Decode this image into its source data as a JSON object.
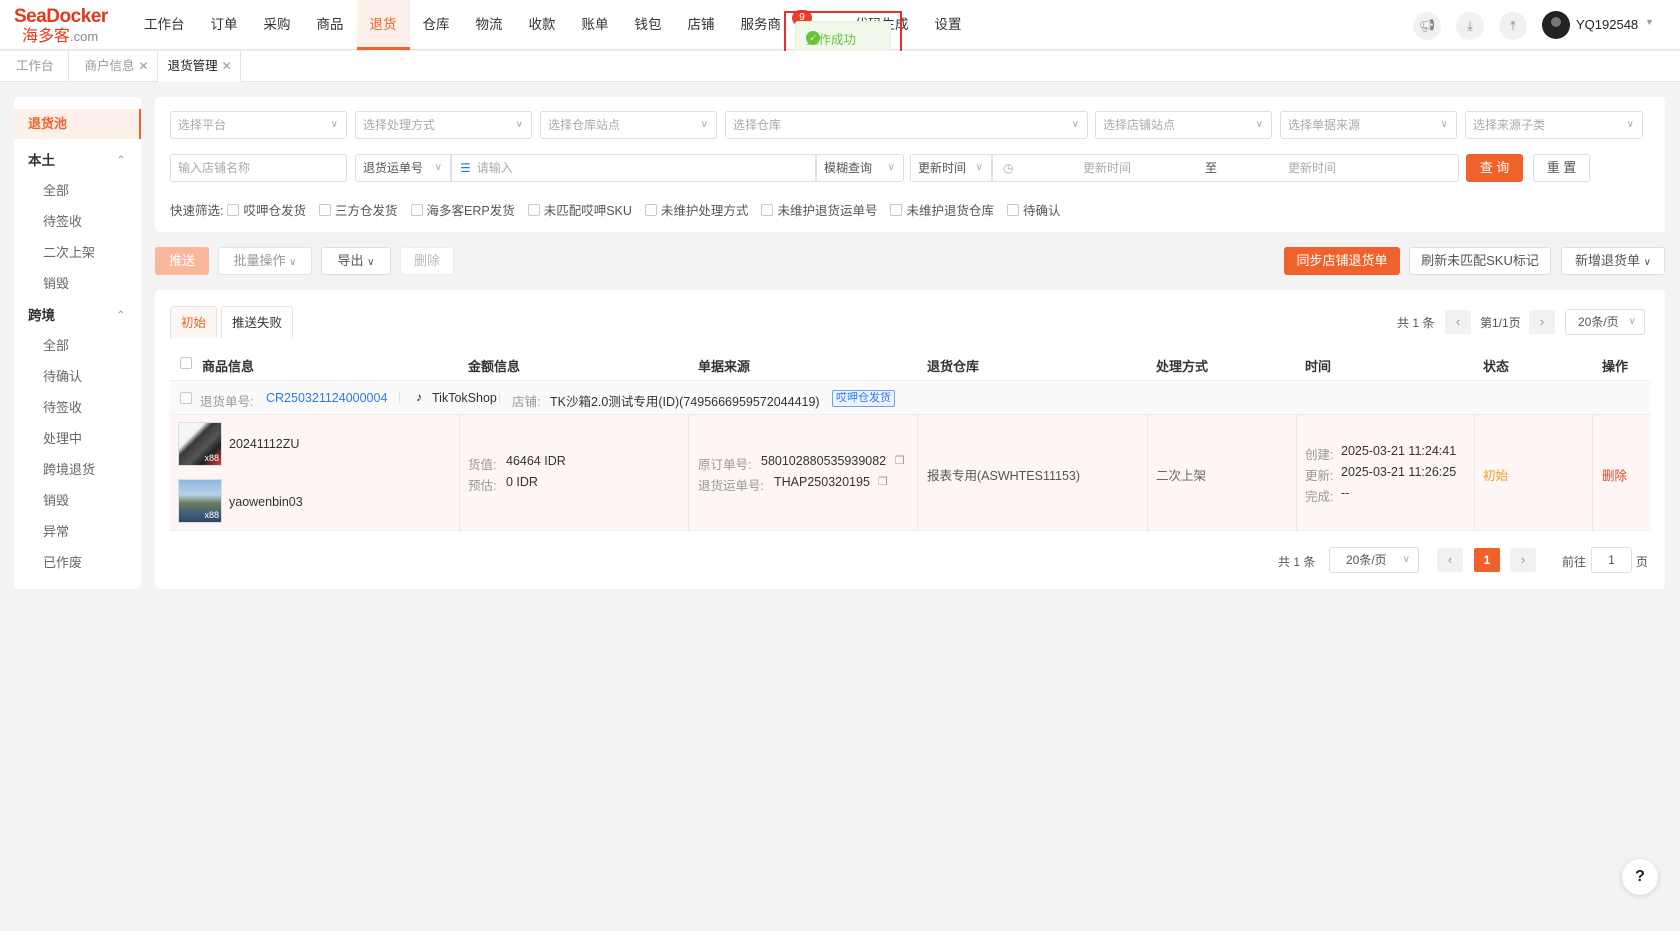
{
  "brand": {
    "en": "SeaDocker",
    "zh": "海多客",
    "suffix": ".com"
  },
  "nav": {
    "items": [
      "工作台",
      "订单",
      "采购",
      "商品",
      "退货",
      "仓库",
      "物流",
      "收款",
      "账单",
      "钱包",
      "店铺",
      "服务商",
      "代码生成",
      "设置"
    ],
    "active": "退货",
    "badge": "9"
  },
  "header": {
    "username": "YQ192548"
  },
  "toast": {
    "message": "操作成功"
  },
  "page_tabs": [
    {
      "label": "工作台",
      "closable": false
    },
    {
      "label": "商户信息",
      "closable": true
    },
    {
      "label": "退货管理",
      "closable": true,
      "active": true
    }
  ],
  "sidebar": {
    "top": "退货池",
    "groups": [
      {
        "title": "本土",
        "items": [
          "全部",
          "待签收",
          "二次上架",
          "销毁"
        ]
      },
      {
        "title": "跨境",
        "items": [
          "全部",
          "待确认",
          "待签收",
          "处理中",
          "跨境退货",
          "销毁",
          "异常",
          "已作废"
        ]
      }
    ]
  },
  "filters": {
    "row1": [
      "选择平台",
      "选择处理方式",
      "选择仓库站点",
      "选择仓库",
      "选择店铺站点",
      "选择单据来源",
      "选择来源子类"
    ],
    "store_name_placeholder": "输入店铺名称",
    "return_no_select": "退货运单号",
    "input_placeholder": "请输入",
    "fuzzy_select": "模糊查询",
    "time_select": "更新时间",
    "date_start_placeholder": "更新时间",
    "date_sep": "至",
    "date_end_placeholder": "更新时间",
    "query_button": "查 询",
    "reset_button": "重 置",
    "quick_label": "快速筛选:",
    "quick_items": [
      "哎呷仓发货",
      "三方仓发货",
      "海多客ERP发货",
      "未匹配哎呷SKU",
      "未维护处理方式",
      "未维护退货运单号",
      "未维护退货仓库",
      "待确认"
    ]
  },
  "actions": {
    "push": "推送",
    "batch": "批量操作",
    "export": "导出",
    "delete": "删除",
    "sync": "同步店铺退货单",
    "refresh": "刷新未匹配SKU标记",
    "add": "新增退货单"
  },
  "table_tabs": [
    "初始",
    "推送失败"
  ],
  "pager_top": {
    "total": "共 1 条",
    "page": "第1/1页",
    "size": "20条/页"
  },
  "columns": [
    "商品信息",
    "金额信息",
    "单据来源",
    "退货仓库",
    "处理方式",
    "时间",
    "状态",
    "操作"
  ],
  "order": {
    "return_no_label": "退货单号:",
    "return_no": "CR250321124000004",
    "platform": "TikTokShop",
    "store_label": "店铺:",
    "store": "TK沙箱2.0测试专用(ID)(7495666959572044419)",
    "tag": "哎呷仓发货"
  },
  "row": {
    "products": [
      {
        "sku": "20241112ZU",
        "qty": "x88"
      },
      {
        "sku": "yaowenbin03",
        "qty": "x88"
      }
    ],
    "amount": {
      "goods_label": "货值:",
      "goods": "46464 IDR",
      "est_label": "预估:",
      "est": "0 IDR"
    },
    "source": {
      "orig_label": "原订单号:",
      "orig": "580102880535939082",
      "ret_label": "退货运单号:",
      "ret": "THAP250320195"
    },
    "warehouse": "报表专用(ASWHTES11153)",
    "method": "二次上架",
    "time": {
      "created_label": "创建:",
      "created": "2025-03-21 11:24:41",
      "updated_label": "更新:",
      "updated": "2025-03-21 11:26:25",
      "done_label": "完成:",
      "done": "--"
    },
    "status": "初始",
    "op": "删除"
  },
  "pager_bottom": {
    "total": "共 1 条",
    "size": "20条/页",
    "current": "1",
    "goto_label": "前往",
    "goto_value": "1",
    "page_unit": "页"
  },
  "colors": {
    "accent": "#f0622b",
    "link": "#2d79e6",
    "success": "#67c23a"
  },
  "help": "?"
}
